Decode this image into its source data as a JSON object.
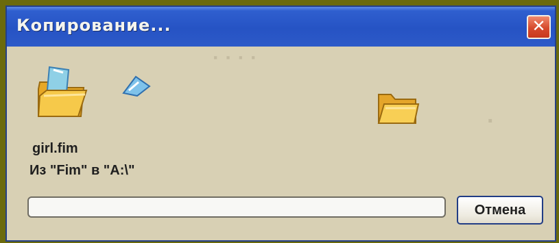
{
  "window": {
    "title": "Копирование...",
    "close_symbol": "✕"
  },
  "copy": {
    "file_name": "girl.fim",
    "path_text": "Из \"Fim\" в \"A:\\\"",
    "progress_fraction": 0
  },
  "buttons": {
    "cancel_label": "Отмена"
  },
  "icons": {
    "source": "source-folder-icon",
    "flying_document": "flying-document-icon",
    "destination": "destination-folder-icon",
    "close": "close-icon"
  },
  "colors": {
    "outer_background": "#6b6a0c",
    "title_bar": "#2653c4",
    "client_background": "#d8d0b4",
    "close_button": "#d64a2d"
  }
}
